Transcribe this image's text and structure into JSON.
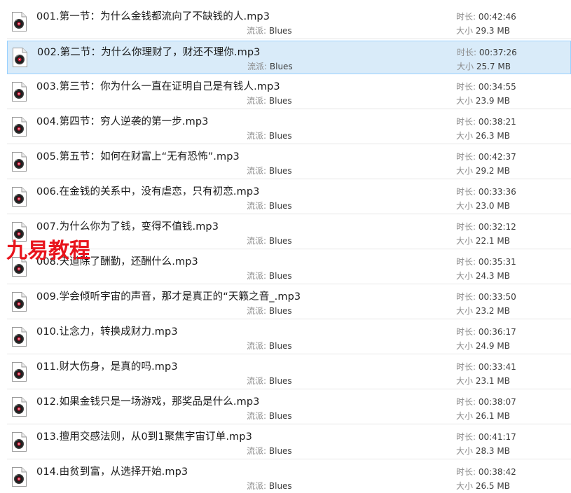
{
  "files": [
    {
      "name": "001.第一节：为什么金钱都流向了不缺钱的人.mp3",
      "genre_label": "流派:",
      "genre": "Blues",
      "duration_label": "时长:",
      "duration": "00:42:46",
      "size_label": "大小",
      "size": "29.3 MB",
      "selected": false
    },
    {
      "name": "002.第二节：为什么你理财了，财还不理你.mp3",
      "genre_label": "流派:",
      "genre": "Blues",
      "duration_label": "时长:",
      "duration": "00:37:26",
      "size_label": "大小",
      "size": "25.7 MB",
      "selected": true
    },
    {
      "name": "003.第三节：你为什么一直在证明自己是有钱人.mp3",
      "genre_label": "流派:",
      "genre": "Blues",
      "duration_label": "时长:",
      "duration": "00:34:55",
      "size_label": "大小",
      "size": "23.9 MB",
      "selected": false
    },
    {
      "name": "004.第四节：穷人逆袭的第一步.mp3",
      "genre_label": "流派:",
      "genre": "Blues",
      "duration_label": "时长:",
      "duration": "00:38:21",
      "size_label": "大小",
      "size": "26.3 MB",
      "selected": false
    },
    {
      "name": "005.第五节：如何在财富上“无有恐怖”.mp3",
      "genre_label": "流派:",
      "genre": "Blues",
      "duration_label": "时长:",
      "duration": "00:42:37",
      "size_label": "大小",
      "size": "29.2 MB",
      "selected": false
    },
    {
      "name": "006.在金钱的关系中，没有虐恋，只有初恋.mp3",
      "genre_label": "流派:",
      "genre": "Blues",
      "duration_label": "时长:",
      "duration": "00:33:36",
      "size_label": "大小",
      "size": "23.0 MB",
      "selected": false
    },
    {
      "name": "007.为什么你为了钱，变得不值钱.mp3",
      "genre_label": "流派:",
      "genre": "Blues",
      "duration_label": "时长:",
      "duration": "00:32:12",
      "size_label": "大小",
      "size": "22.1 MB",
      "selected": false
    },
    {
      "name": "008.天道除了酬勤，还酬什么.mp3",
      "genre_label": "流派:",
      "genre": "Blues",
      "duration_label": "时长:",
      "duration": "00:35:31",
      "size_label": "大小",
      "size": "24.3 MB",
      "selected": false
    },
    {
      "name": "009.学会倾听宇宙的声音，那才是真正的“天籁之音_.mp3",
      "genre_label": "流派:",
      "genre": "Blues",
      "duration_label": "时长:",
      "duration": "00:33:50",
      "size_label": "大小",
      "size": "23.2 MB",
      "selected": false
    },
    {
      "name": "010.让念力，转换成财力.mp3",
      "genre_label": "流派:",
      "genre": "Blues",
      "duration_label": "时长:",
      "duration": "00:36:17",
      "size_label": "大小",
      "size": "24.9 MB",
      "selected": false
    },
    {
      "name": "011.财大伤身，是真的吗.mp3",
      "genre_label": "流派:",
      "genre": "Blues",
      "duration_label": "时长:",
      "duration": "00:33:41",
      "size_label": "大小",
      "size": "23.1 MB",
      "selected": false
    },
    {
      "name": "012.如果金钱只是一场游戏，那奖品是什么.mp3",
      "genre_label": "流派:",
      "genre": "Blues",
      "duration_label": "时长:",
      "duration": "00:38:07",
      "size_label": "大小",
      "size": "26.1 MB",
      "selected": false
    },
    {
      "name": "013.擅用交感法则，从0到1聚焦宇宙订单.mp3",
      "genre_label": "流派:",
      "genre": "Blues",
      "duration_label": "时长:",
      "duration": "00:41:17",
      "size_label": "大小",
      "size": "28.3 MB",
      "selected": false
    },
    {
      "name": "014.由贫到富，从选择开始.mp3",
      "genre_label": "流派:",
      "genre": "Blues",
      "duration_label": "时长:",
      "duration": "00:38:42",
      "size_label": "大小",
      "size": "26.5 MB",
      "selected": false
    }
  ],
  "file_icon": "audio-file-icon",
  "watermark": {
    "text": "九易教程",
    "color": "#e8141c"
  },
  "colors": {
    "selection_bg": "#d9ebf9",
    "selection_border": "#99d1ff",
    "row_divider": "#e6e6e6",
    "name_text": "#1a1a1a",
    "meta_text": "#6d6d6d"
  }
}
